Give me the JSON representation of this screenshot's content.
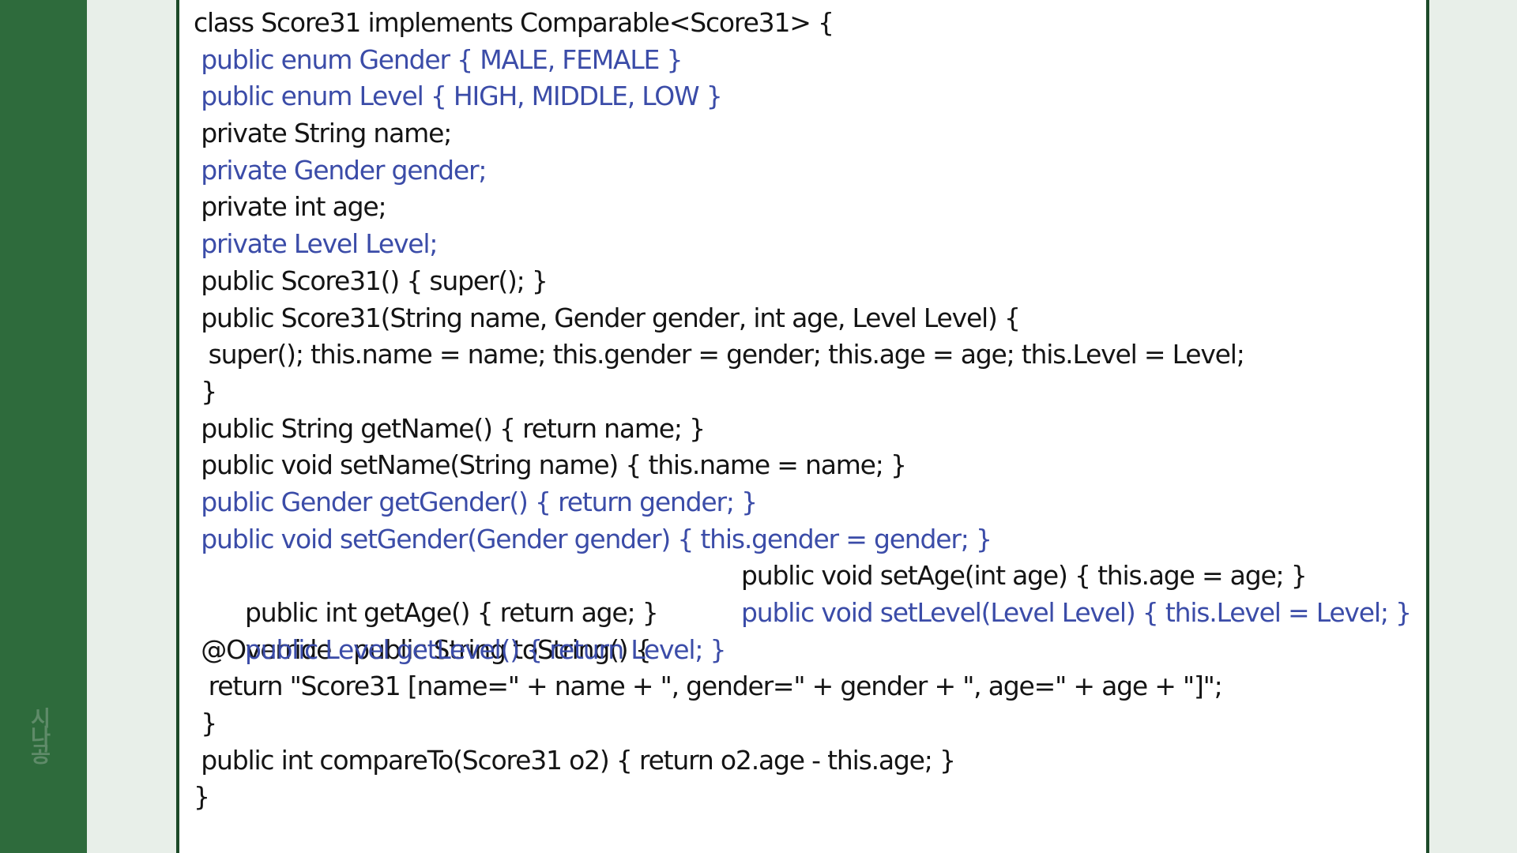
{
  "watermark": "시나공",
  "code_lines": [
    {
      "text": "class Score31 implements Comparable<Score31> {",
      "color": "#141414"
    },
    {
      "text": " public enum Gender { MALE, FEMALE }",
      "color": "#3b4ca8"
    },
    {
      "text": " public enum Level { HIGH, MIDDLE, LOW }",
      "color": "#3b4ca8"
    },
    {
      "text": " private String name;",
      "color": "#141414"
    },
    {
      "text": " private Gender gender;",
      "color": "#3b4ca8"
    },
    {
      "text": " private int age;",
      "color": "#141414"
    },
    {
      "text": " private Level Level;",
      "color": "#3b4ca8"
    },
    {
      "text": " public Score31() { super(); }",
      "color": "#141414"
    },
    {
      "text": " public Score31(String name, Gender gender, int age, Level Level) {",
      "color": "#141414"
    },
    {
      "text": "  super(); this.name = name; this.gender = gender; this.age = age; this.Level = Level;",
      "color": "#141414"
    },
    {
      "text": " }",
      "color": "#141414"
    },
    {
      "text": " public String getName() { return name; }",
      "color": "#141414"
    },
    {
      "text": " public void setName(String name) { this.name = name; }",
      "color": "#141414"
    },
    {
      "text": " public Gender getGender() { return gender; }",
      "color": "#3b4ca8"
    },
    {
      "text": " public void setGender(Gender gender) { this.gender = gender; }",
      "color": "#3b4ca8"
    },
    {
      "text": " public int getAge() { return age; }",
      "text2": "public void setAge(int age) { this.age = age; }",
      "color": "#141414"
    },
    {
      "text": " public Level getLevel() { return Level; }",
      "text2": "public void setLevel(Level Level) { this.Level = Level; }",
      "color": "#3b4ca8"
    },
    {
      "text": " @Override   public String toString() {",
      "color": "#141414"
    },
    {
      "text": "  return \"Score31 [name=\" + name + \", gender=\" + gender + \", age=\" + age + \"]\";",
      "color": "#141414"
    },
    {
      "text": " }",
      "color": "#141414"
    },
    {
      "text": " public int compareTo(Score31 o2) { return o2.age - this.age; }",
      "color": "#141414"
    },
    {
      "text": "}",
      "color": "#141414"
    }
  ]
}
